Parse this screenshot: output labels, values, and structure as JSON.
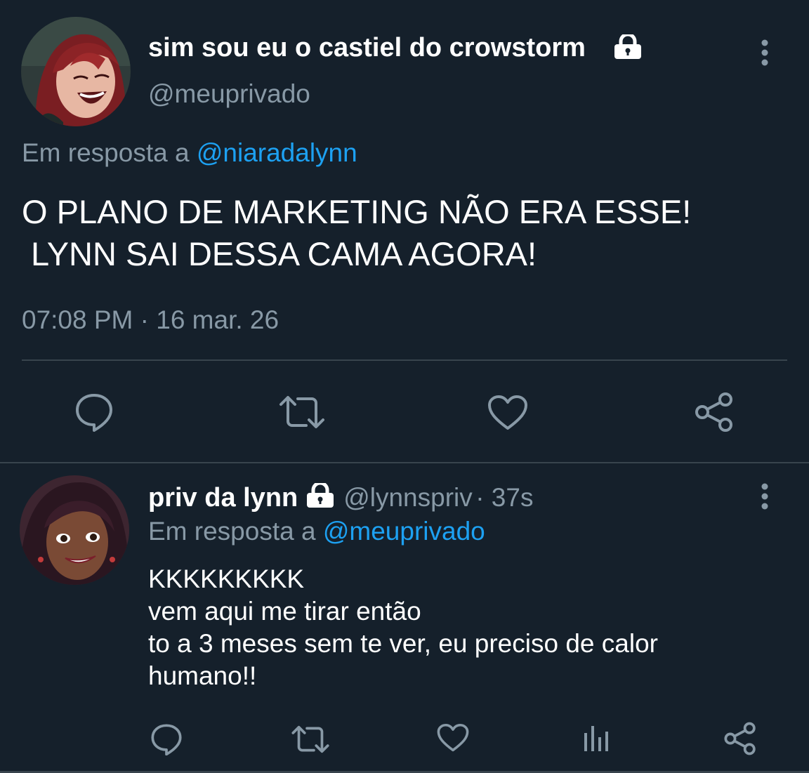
{
  "main_tweet": {
    "display_name": "sim sou eu o castiel do crowstorm",
    "handle": "@meuprivado",
    "reply_prefix": "Em resposta a",
    "reply_to": "@niaradalynn",
    "text_lines": [
      "O PLANO DE MARKETING NÃO ERA ESSE!",
      " LYNN SAI DESSA CAMA AGORA!"
    ],
    "timestamp": "07:08 PM · 16 mar. 26",
    "icons": [
      "lock-icon",
      "more-icon",
      "reply-icon",
      "retweet-icon",
      "like-icon",
      "share-icon"
    ]
  },
  "reply_tweet": {
    "display_name": "priv da lynn",
    "handle": "@lynnspriv",
    "time": "· 37s",
    "reply_prefix": "Em resposta a",
    "reply_to": "@meuprivado",
    "text_lines": [
      "KKKKKKKKK",
      "vem aqui me tirar então",
      "to a 3 meses sem te ver, eu preciso de calor",
      "humano!!"
    ],
    "icons": [
      "lock-icon",
      "more-icon",
      "reply-icon",
      "retweet-icon",
      "like-icon",
      "analytics-icon",
      "share-icon"
    ]
  },
  "colors": {
    "background": "#15202b",
    "text": "#ffffff",
    "muted": "#8899a6",
    "link": "#1da1f2",
    "divider": "#38444d"
  }
}
